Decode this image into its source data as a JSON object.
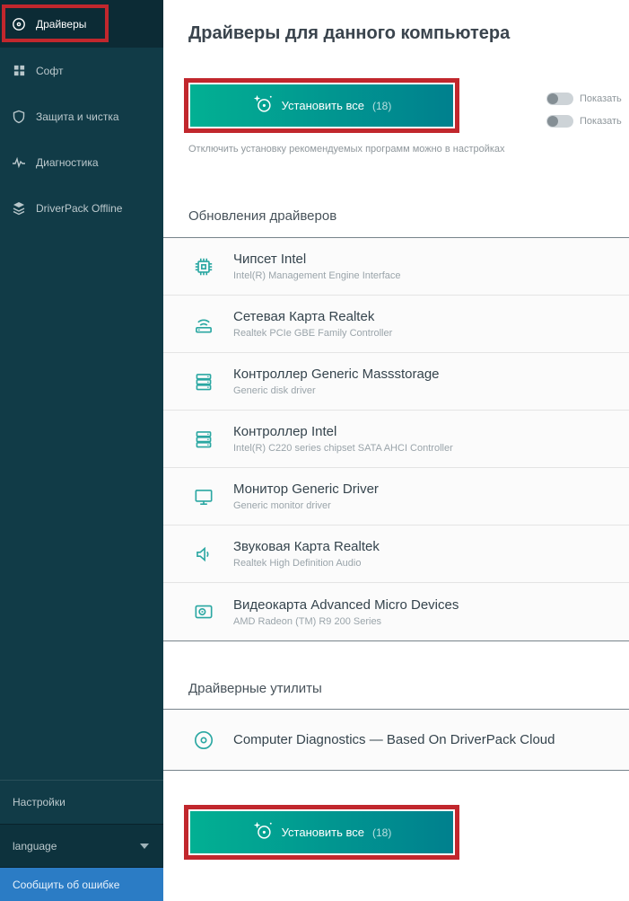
{
  "sidebar": {
    "items": [
      {
        "label": "Драйверы",
        "icon": "disc-icon",
        "active": true
      },
      {
        "label": "Софт",
        "icon": "grid-icon",
        "active": false
      },
      {
        "label": "Защита и чистка",
        "icon": "shield-icon",
        "active": false
      },
      {
        "label": "Диагностика",
        "icon": "pulse-icon",
        "active": false
      },
      {
        "label": "DriverPack Offline",
        "icon": "layers-icon",
        "active": false
      }
    ],
    "settings_label": "Настройки",
    "language_label": "language",
    "report_error_label": "Сообщить об ошибке"
  },
  "main": {
    "title": "Драйверы для данного компьютера",
    "install_button": {
      "label": "Установить все",
      "count": "(18)",
      "icon": "disc-sparkle-icon"
    },
    "note": "Отключить установку рекомендуемых программ можно в настройках",
    "toggles": [
      {
        "label": "Показать",
        "state": "off"
      },
      {
        "label": "Показать",
        "state": "off"
      }
    ],
    "driver_updates": {
      "header": "Обновления драйверов",
      "items": [
        {
          "title": "Чипсет Intel",
          "subtitle": "Intel(R) Management Engine Interface",
          "icon": "chipset-icon"
        },
        {
          "title": "Сетевая Карта Realtek",
          "subtitle": "Realtek PCIe GBE Family Controller",
          "icon": "network-icon"
        },
        {
          "title": "Контроллер Generic Massstorage",
          "subtitle": "Generic disk driver",
          "icon": "storage-icon"
        },
        {
          "title": "Контроллер Intel",
          "subtitle": "Intel(R) C220 series chipset SATA AHCI Controller",
          "icon": "storage-icon"
        },
        {
          "title": "Монитор Generic Driver",
          "subtitle": "Generic monitor driver",
          "icon": "monitor-icon"
        },
        {
          "title": "Звуковая Карта Realtek",
          "subtitle": "Realtek High Definition Audio",
          "icon": "speaker-icon"
        },
        {
          "title": "Видеокарта Advanced Micro Devices",
          "subtitle": "AMD Radeon (TM) R9 200 Series",
          "icon": "gpu-icon"
        }
      ]
    },
    "driver_utilities": {
      "header": "Драйверные утилиты",
      "items": [
        {
          "title": "Computer Diagnostics — Based On DriverPack Cloud",
          "icon": "cd-icon"
        }
      ]
    },
    "install_button_bottom": {
      "label": "Установить все",
      "count": "(18)",
      "icon": "disc-sparkle-icon"
    }
  },
  "colors": {
    "highlight_red": "#c1272d",
    "button_gradient_start": "#02b093",
    "button_gradient_end": "#00808e",
    "sidebar_bg": "#113b47",
    "sidebar_active_bg": "#0c2b35",
    "report_blue": "#2b7cc5",
    "icon_teal": "#2aa7a2"
  }
}
